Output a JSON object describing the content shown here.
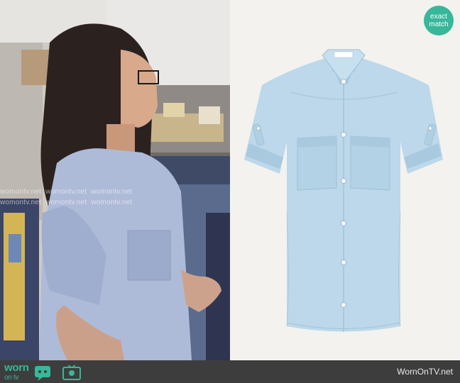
{
  "badge": {
    "line1": "exact",
    "line2": "match"
  },
  "watermark": {
    "text": "womontv.net"
  },
  "footer": {
    "brand_line1": "worn",
    "brand_line2": "on tv",
    "url": "WornOnTV.net"
  },
  "colors": {
    "accent": "#38b79a",
    "footer_bg": "#3d3d3d",
    "shirt_blue": "#b8d5e8"
  },
  "icons": [
    "speech-bubble-icon",
    "tv-icon"
  ]
}
